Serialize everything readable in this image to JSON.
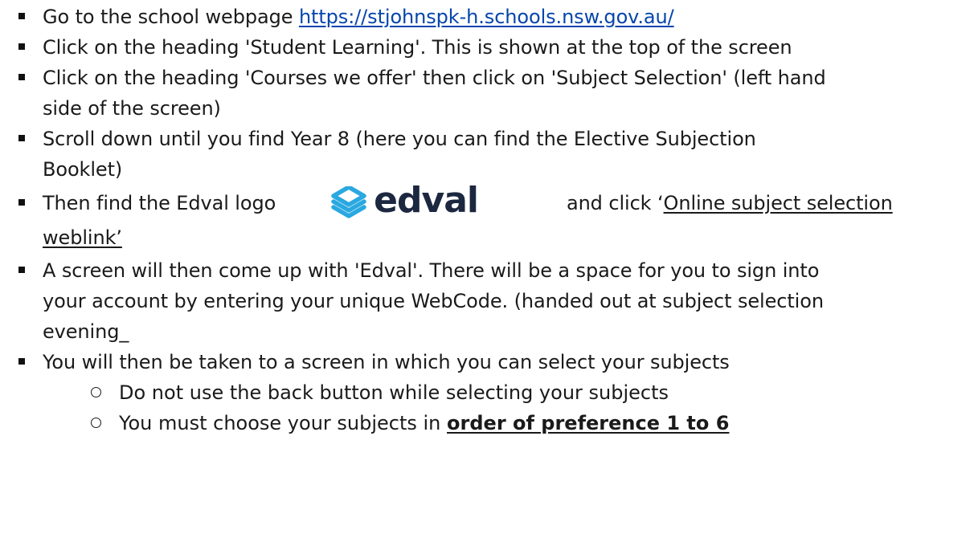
{
  "steps": [
    {
      "text_before": "Go to the school webpage ",
      "link": "https://stjohnspk-h.schools.nsw.gov.au/"
    },
    {
      "text": "Click on the heading 'Student Learning'. This is shown at the top of the screen"
    },
    {
      "line1": "Click on the heading 'Courses we offer' then click on 'Subject Selection' (left hand",
      "line2": "side of the screen)"
    },
    {
      "line1": "Scroll down until you find Year 8 (here you can find the Elective Subjection",
      "line2": "Booklet)"
    },
    {
      "text_before": "Then find the Edval logo",
      "logo_word": "edval",
      "text_after": "and click ‘",
      "link_line1": "Online subject selection",
      "link_line2": "weblink’"
    },
    {
      "line1": "A screen will then come up with 'Edval'. There will be a space for you to sign into",
      "line2": "your account by entering your unique WebCode. (handed out at subject selection",
      "line3": "evening_"
    },
    {
      "text": "You will then be taken to a screen in which you can select your subjects"
    }
  ],
  "substeps": [
    {
      "text": "Do not use the back button while selecting your subjects"
    },
    {
      "text_before": "You must choose your subjects in ",
      "emphasis": "order of preference 1 to 6"
    }
  ],
  "colors": {
    "link": "#0645ad",
    "logo_blue": "#2aa8e0",
    "logo_text": "#1c2740"
  },
  "icons": {
    "bullet": "square-bullet",
    "sub_bullet": "hollow-circle-bullet",
    "logo": "edval-logo"
  }
}
